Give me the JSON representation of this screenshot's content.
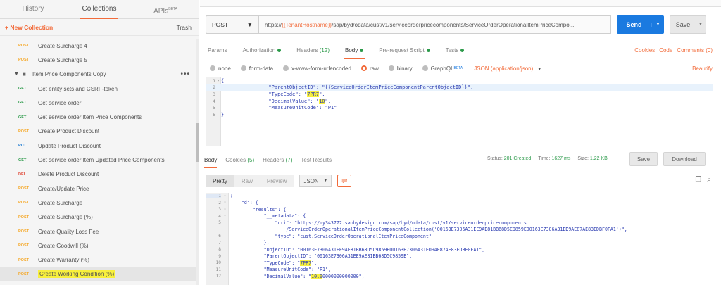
{
  "sidebar": {
    "tabs": [
      {
        "label": "History"
      },
      {
        "label": "Collections"
      },
      {
        "label": "APIs",
        "badge": "BETA"
      }
    ],
    "new_collection": "+ New Collection",
    "trash": "Trash",
    "items": [
      {
        "type": "request",
        "method": "POST",
        "name": "Create Surcharge 4"
      },
      {
        "type": "request",
        "method": "POST",
        "name": "Create Surcharge 5"
      },
      {
        "type": "folder",
        "name": "Item Price Components Copy",
        "menu": "•••"
      },
      {
        "type": "request",
        "method": "GET",
        "name": "Get entity sets and CSRF-token"
      },
      {
        "type": "request",
        "method": "GET",
        "name": "Get service order"
      },
      {
        "type": "request",
        "method": "GET",
        "name": "Get service order Item Price Components"
      },
      {
        "type": "request",
        "method": "POST",
        "name": "Create Product Discount"
      },
      {
        "type": "request",
        "method": "PUT",
        "name": "Update Product Discount"
      },
      {
        "type": "request",
        "method": "GET",
        "name": "Get service order Item Updated Price Components"
      },
      {
        "type": "request",
        "method": "DEL",
        "name": "Delete Product Discount"
      },
      {
        "type": "request",
        "method": "POST",
        "name": "Create/Update Price"
      },
      {
        "type": "request",
        "method": "POST",
        "name": "Create Surcharge"
      },
      {
        "type": "request",
        "method": "POST",
        "name": "Create Surcharge (%)"
      },
      {
        "type": "request",
        "method": "POST",
        "name": "Create Quality Loss Fee"
      },
      {
        "type": "request",
        "method": "POST",
        "name": "Create Goodwill (%)"
      },
      {
        "type": "request",
        "method": "POST",
        "name": "Create Warranty (%)"
      },
      {
        "type": "request",
        "method": "POST",
        "name": "Create Working Condition (%)",
        "selected": true
      }
    ]
  },
  "request": {
    "method": "POST",
    "url_prefix": "https://",
    "url_var": "{{TenantHostname}}",
    "url_rest": "/sap/byd/odata/cust/v1/serviceorderpricecomponents/ServiceOrderOperationalItemPriceCompo...",
    "send": "Send",
    "save": "Save",
    "tabs": [
      {
        "label": "Params"
      },
      {
        "label": "Authorization",
        "dot": true
      },
      {
        "label": "Headers",
        "count": "(12)"
      },
      {
        "label": "Body",
        "dot": true,
        "active": true
      },
      {
        "label": "Pre-request Script",
        "dot": true
      },
      {
        "label": "Tests",
        "dot": true
      }
    ],
    "links": [
      "Cookies",
      "Code",
      "Comments (0)"
    ],
    "body_types": [
      {
        "label": "none"
      },
      {
        "label": "form-data"
      },
      {
        "label": "x-www-form-urlencoded"
      },
      {
        "label": "raw",
        "on": true
      },
      {
        "label": "binary"
      },
      {
        "label": "GraphQL",
        "badge": "BETA"
      }
    ],
    "content_type": "JSON (application/json)",
    "beautify": "Beautify",
    "body_lines": [
      {
        "n": "1",
        "fold": "▾",
        "pre": "{",
        "hl": "",
        "post": ""
      },
      {
        "n": "2",
        "fold": "",
        "pre": "                \"ParentObjectID\": \"{{ServiceOrderItemPriceComponentParentObjectID}}\",",
        "hl": "",
        "post": "",
        "cur": true
      },
      {
        "n": "3",
        "fold": "",
        "pre": "                \"TypeCode\": \"",
        "hl": "7PR7",
        "post": "\","
      },
      {
        "n": "4",
        "fold": "",
        "pre": "                \"DecimalValue\": \"",
        "hl": "10",
        "post": "\","
      },
      {
        "n": "5",
        "fold": "",
        "pre": "                \"MeasureUnitCode\": \"P1\"",
        "hl": "",
        "post": ""
      },
      {
        "n": "6",
        "fold": "",
        "pre": "}",
        "hl": "",
        "post": ""
      }
    ]
  },
  "response": {
    "tabs": [
      {
        "label": "Body",
        "active": true
      },
      {
        "label": "Cookies",
        "count": "(5)"
      },
      {
        "label": "Headers",
        "count": "(7)"
      },
      {
        "label": "Test Results"
      }
    ],
    "status_label": "Status:",
    "status_value": "201 Created",
    "time_label": "Time:",
    "time_value": "1627 ms",
    "size_label": "Size:",
    "size_value": "1.22 KB",
    "save": "Save",
    "download": "Download",
    "views": [
      "Pretty",
      "Raw",
      "Preview"
    ],
    "format": "JSON",
    "lines": [
      {
        "n": "1",
        "fold": "▾",
        "pre": "{",
        "hl": "",
        "post": "",
        "cur": true
      },
      {
        "n": "2",
        "fold": "▾",
        "pre": "    \"d\": {",
        "hl": "",
        "post": ""
      },
      {
        "n": "3",
        "fold": "▾",
        "pre": "        \"results\": {",
        "hl": "",
        "post": ""
      },
      {
        "n": "4",
        "fold": "▾",
        "pre": "            \"__metadata\": {",
        "hl": "",
        "post": ""
      },
      {
        "n": "5",
        "fold": "",
        "pre": "                \"uri\": \"https://my343772.sapbydesign.com/sap/byd/odata/cust/v1/serviceorderpricecomponents",
        "hl": "",
        "post": ""
      },
      {
        "n": "",
        "fold": "",
        "pre": "                    /ServiceOrderOperationalItemPriceComponentCollection('00163E7306A31EE9AE81BB68D5C9859E00163E7306A31ED9AE87AE83EDBF0FA1')\",",
        "hl": "",
        "post": ""
      },
      {
        "n": "6",
        "fold": "",
        "pre": "                \"type\": \"cust.ServiceOrderOperationalItemPriceComponent\"",
        "hl": "",
        "post": ""
      },
      {
        "n": "7",
        "fold": "",
        "pre": "            },",
        "hl": "",
        "post": ""
      },
      {
        "n": "8",
        "fold": "",
        "pre": "            \"ObjectID\": \"00163E7306A31EE9AE81BB68D5C9859E00163E7306A31ED9AE87AE83EDBF0FA1\",",
        "hl": "",
        "post": ""
      },
      {
        "n": "9",
        "fold": "",
        "pre": "            \"ParentObjectID\": \"00163E7306A31EE9AE81BB68D5C9859E\",",
        "hl": "",
        "post": ""
      },
      {
        "n": "10",
        "fold": "",
        "pre": "            \"TypeCode\": \"",
        "hl": "7PR7",
        "post": "\","
      },
      {
        "n": "11",
        "fold": "",
        "pre": "            \"MeasureUnitCode\": \"P1\",",
        "hl": "",
        "post": ""
      },
      {
        "n": "12",
        "fold": "",
        "pre": "            \"DecimalValue\": \"",
        "hl": "10.0",
        "post": "0000000000000\","
      }
    ]
  },
  "colors": {
    "accent": "#f26b3a",
    "send": "#1a7ae0",
    "post": "#f5a623",
    "get": "#2c9a4a",
    "put": "#1f7bd1",
    "del": "#e04a3a",
    "highlight": "#f8f03c"
  }
}
